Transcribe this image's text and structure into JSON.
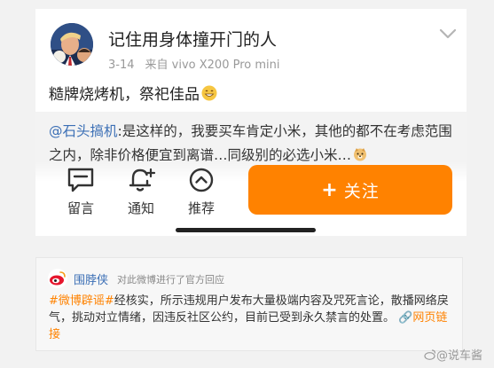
{
  "post": {
    "username": "记住用身体撞开门的人",
    "date": "3-14",
    "source_prefix": "来自",
    "device": "vivo X200 Pro mini",
    "text": "糙牌烧烤机，祭祀佳品",
    "emoji_icon": "grin-emoji-icon"
  },
  "quote": {
    "mention": "@石头搞机",
    "text": ":是这样的，我要买车肯定小米，其他的都不在考虑范围之内，除非价格便宜到离谱…同级别的必选小米…",
    "emoji_icon": "doge-emoji-icon"
  },
  "actions": {
    "comment_label": "留言",
    "notify_label": "通知",
    "recommend_label": "推荐",
    "follow_label": "关注",
    "follow_color": "#ff8200"
  },
  "notice": {
    "name": "围脖侠",
    "description": "对此微博进行了官方回应",
    "tag": "#微博辟谣#",
    "body": "经核实，所示违规用户发布大量极端内容及咒死言论，散播网络戾气，挑动对立情绪，因违反社区公约，目前已受到永久禁言的处置。",
    "link_label": "网页链接"
  },
  "watermark": "@说车酱"
}
